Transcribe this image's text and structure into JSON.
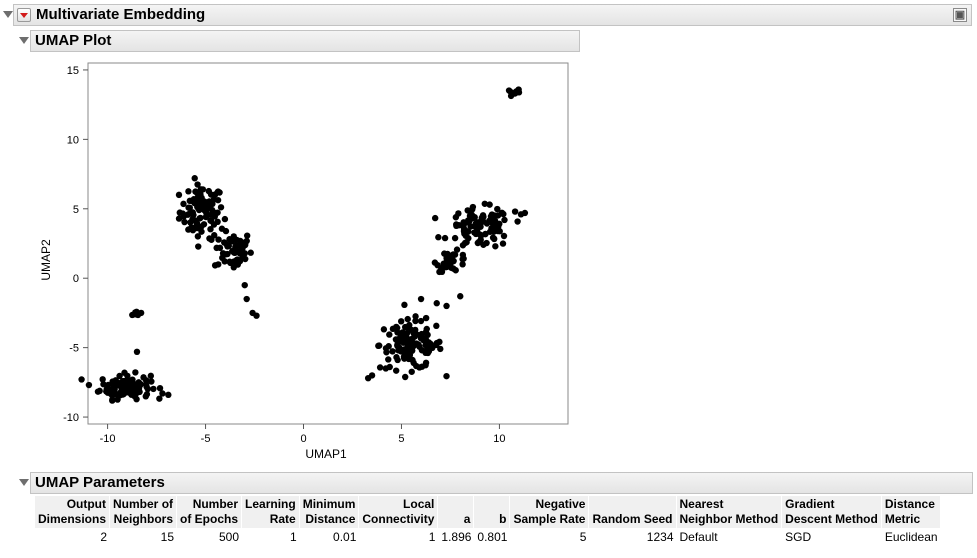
{
  "report": {
    "title": "Multivariate Embedding"
  },
  "plot": {
    "title": "UMAP Plot",
    "xlabel": "UMAP1",
    "ylabel": "UMAP2"
  },
  "chart_data": {
    "type": "scatter",
    "xlabel": "UMAP1",
    "ylabel": "UMAP2",
    "xlim": [
      -11,
      13.5
    ],
    "ylim": [
      -10.5,
      15.5
    ],
    "xticks": [
      -10,
      -5,
      0,
      5,
      10
    ],
    "yticks": [
      -10,
      -5,
      0,
      5,
      10,
      15
    ],
    "grid": false,
    "marker_color": "#000000",
    "clusters": [
      {
        "center": [
          -5.2,
          4.8
        ],
        "spread": [
          0.7,
          1.2
        ],
        "n": 90
      },
      {
        "center": [
          -3.6,
          2.0
        ],
        "spread": [
          0.6,
          0.9
        ],
        "n": 55
      },
      {
        "center": [
          -9.1,
          -7.8
        ],
        "spread": [
          0.8,
          0.55
        ],
        "n": 110
      },
      {
        "center": [
          -8.5,
          -2.6
        ],
        "spread": [
          0.15,
          0.15
        ],
        "n": 6
      },
      {
        "center": [
          10.8,
          13.4
        ],
        "spread": [
          0.25,
          0.1
        ],
        "n": 10
      },
      {
        "center": [
          5.5,
          -4.8
        ],
        "spread": [
          1.0,
          1.1
        ],
        "n": 120
      },
      {
        "center": [
          9.0,
          3.6
        ],
        "spread": [
          1.0,
          0.9
        ],
        "n": 90
      },
      {
        "center": [
          7.6,
          1.2
        ],
        "spread": [
          0.5,
          0.45
        ],
        "n": 30
      }
    ],
    "points": [
      [
        -2.4,
        -2.7
      ],
      [
        -2.6,
        -2.5
      ],
      [
        -2.9,
        -1.5
      ],
      [
        -3.0,
        -0.5
      ],
      [
        -8.5,
        -5.3
      ],
      [
        -7.2,
        -8.3
      ],
      [
        -6.9,
        -8.4
      ],
      [
        4.2,
        -6.5
      ],
      [
        3.5,
        -7.0
      ],
      [
        3.3,
        -7.2
      ],
      [
        6.0,
        -1.5
      ],
      [
        6.8,
        -1.8
      ],
      [
        7.3,
        -2.0
      ],
      [
        8.0,
        -1.3
      ],
      [
        11.1,
        4.6
      ],
      [
        11.3,
        4.7
      ],
      [
        10.8,
        4.8
      ],
      [
        9.5,
        5.3
      ]
    ]
  },
  "params": {
    "section_title": "UMAP Parameters",
    "headers": [
      [
        "Output",
        "Dimensions"
      ],
      [
        "Number of",
        "Neighbors"
      ],
      [
        "Number",
        "of Epochs"
      ],
      [
        "Learning",
        "Rate"
      ],
      [
        "Minimum",
        "Distance"
      ],
      [
        "Local",
        "Connectivity"
      ],
      [
        "",
        "a"
      ],
      [
        "",
        "b"
      ],
      [
        "Negative",
        "Sample Rate"
      ],
      [
        "",
        "Random Seed"
      ],
      [
        "Nearest",
        "Neighbor Method"
      ],
      [
        "Gradient",
        "Descent Method"
      ],
      [
        "Distance",
        "Metric"
      ]
    ],
    "row": [
      "2",
      "15",
      "500",
      "1",
      "0.01",
      "1",
      "1.896",
      "0.801",
      "5",
      "1234",
      "Default",
      "SGD",
      "Euclidean"
    ]
  }
}
